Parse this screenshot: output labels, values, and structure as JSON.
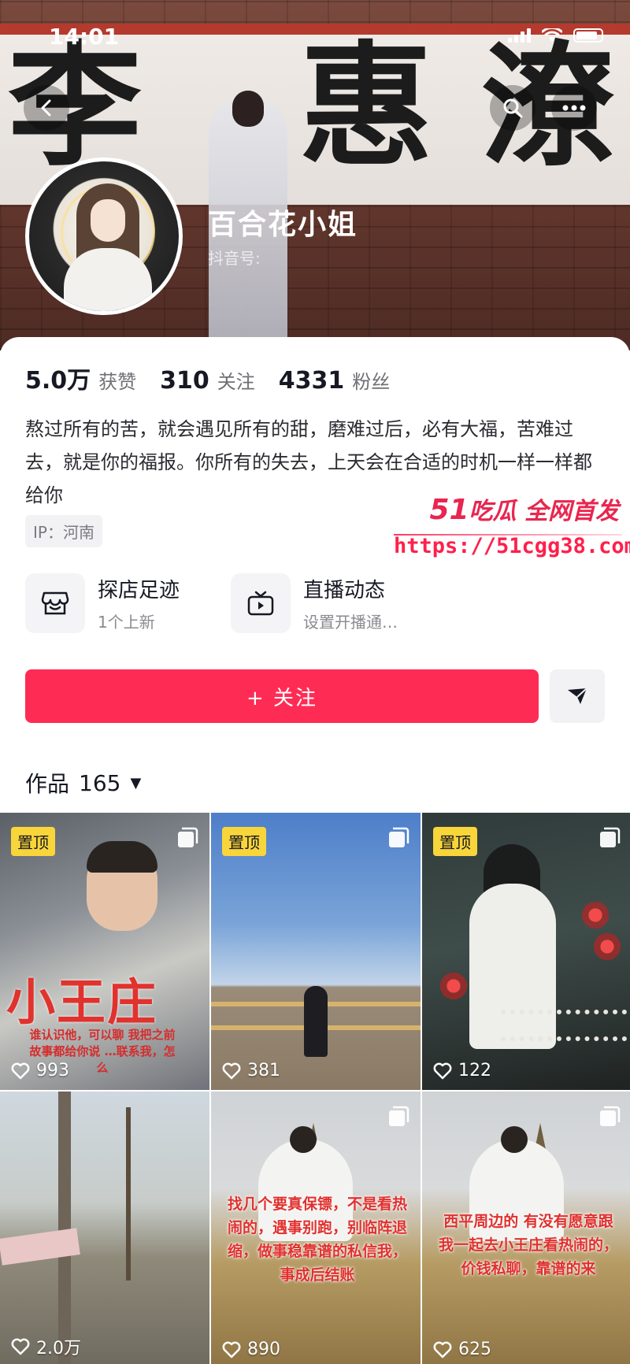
{
  "status_bar": {
    "time": "14:01"
  },
  "banner": {
    "sign_glyphs": [
      "李",
      "惠",
      "潦"
    ]
  },
  "profile": {
    "name": "百合花小姐",
    "id_label": "抖音号:"
  },
  "stats": [
    {
      "value": "5.0万",
      "label": "获赞"
    },
    {
      "value": "310",
      "label": "关注"
    },
    {
      "value": "4331",
      "label": "粉丝"
    }
  ],
  "bio": "熬过所有的苦，就会遇见所有的甜，磨难过后，必有大福，苦难过去，就是你的福报。你所有的失去，上天会在合适的时机一样一样都给你",
  "ip_tag": "IP：河南",
  "watermark": {
    "brand_num": "51",
    "brand_text": "吃瓜 全网首发",
    "url": "https://51cgg38.com"
  },
  "features": [
    {
      "title": "探店足迹",
      "subtitle": "1个上新",
      "icon": "shop-icon"
    },
    {
      "title": "直播动态",
      "subtitle": "设置开播通…",
      "icon": "tv-icon"
    }
  ],
  "follow_button": "+ 关注",
  "works": {
    "label": "作品",
    "count": "165"
  },
  "posts": [
    {
      "pinned": "置顶",
      "likes": "993",
      "overlay_title": "小王庄",
      "overlay_caption": "谁认识他，可以聊 我把之前故事都给你说 …联系我，怎么"
    },
    {
      "pinned": "置顶",
      "likes": "381"
    },
    {
      "pinned": "置顶",
      "likes": "122"
    },
    {
      "likes": "2.0万"
    },
    {
      "likes": "890",
      "overlay_text": "找几个要真保镖，不是看热闹的，遇事别跑，别临阵退缩，做事稳靠谱的私信我，事成后结账"
    },
    {
      "likes": "625",
      "overlay_text": "西平周边的 有没有愿意跟我一起去小王庄看热闹的，价钱私聊，靠谱的来"
    }
  ],
  "colors": {
    "accent": "#fe2c55",
    "pin_badge": "#f8d53a",
    "overlay_red": "#e0312e"
  }
}
